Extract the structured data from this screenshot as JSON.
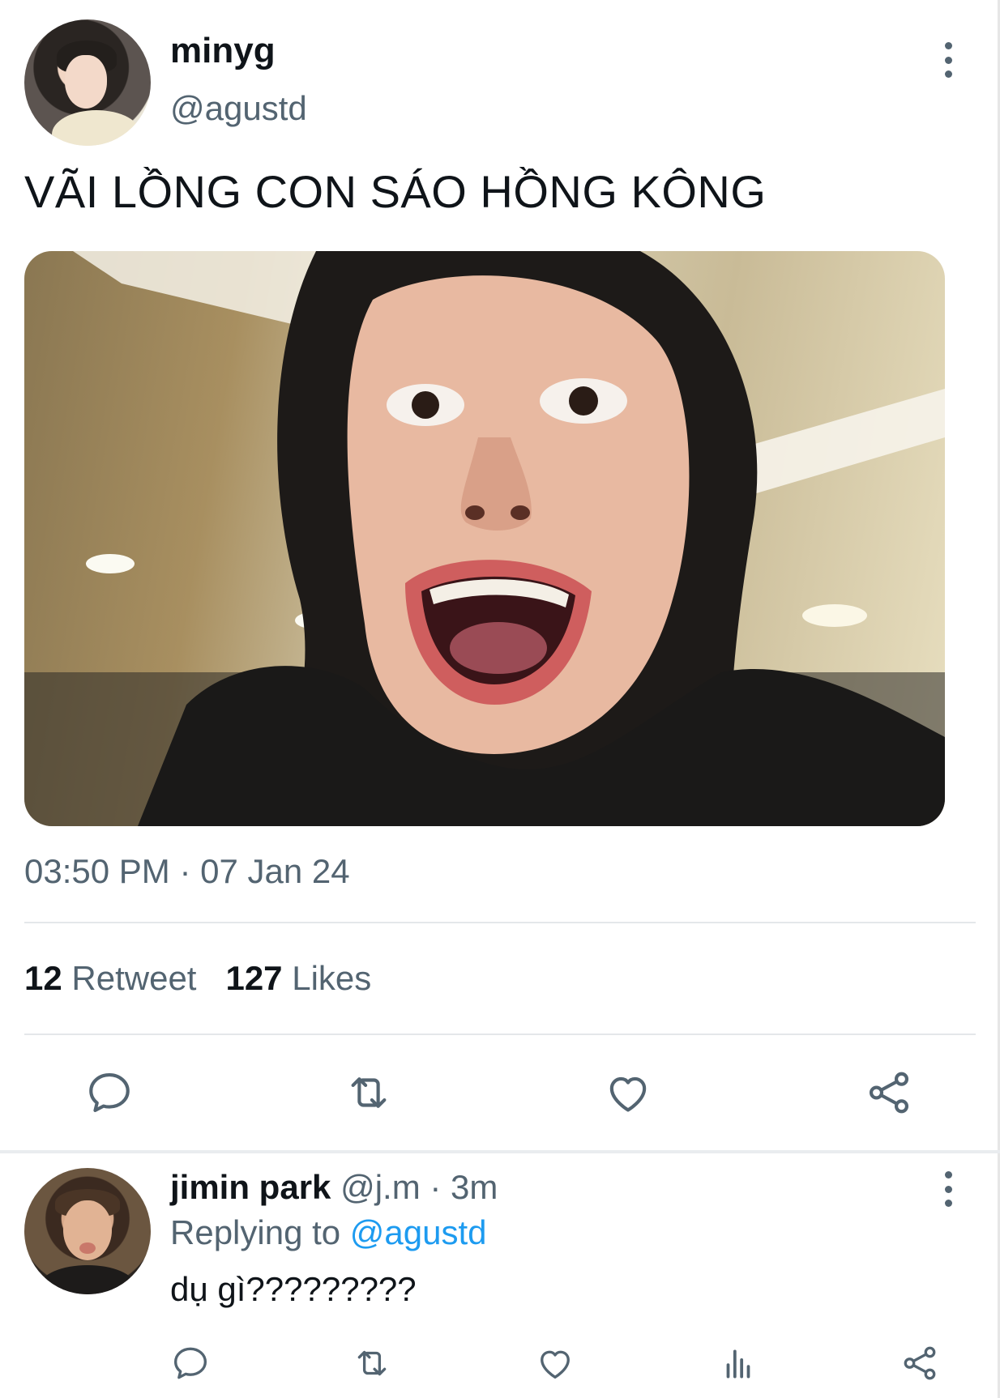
{
  "tweet": {
    "display_name": "minyg",
    "handle": "@agustd",
    "text": "VÃI LỒNG CON SÁO HỒNG KÔNG",
    "timestamp": "03:50 PM · 07 Jan 24",
    "retweet_count": "12",
    "retweet_label": "Retweet",
    "like_count": "127",
    "like_label": "Likes",
    "actions": [
      "reply-icon",
      "retweet-icon",
      "like-icon",
      "share-icon"
    ]
  },
  "reply": {
    "display_name": "jimin park",
    "handle": "@j.m",
    "time": "· 3m",
    "replying_prefix": "Replying to",
    "replying_to": "@agustd",
    "text": "dụ gì?????????",
    "actions": [
      "reply-icon",
      "retweet-icon",
      "like-icon",
      "analytics-icon",
      "share-icon"
    ]
  },
  "colors": {
    "text_primary": "#0f1419",
    "text_secondary": "#536471",
    "link": "#1d9bf0",
    "divider": "#e4e7ea"
  }
}
